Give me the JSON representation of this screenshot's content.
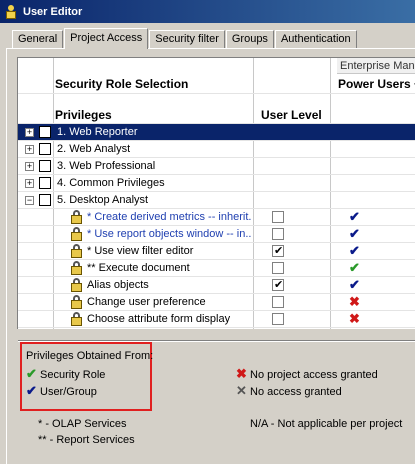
{
  "window": {
    "title": "User Editor"
  },
  "tabs": [
    {
      "label": "General"
    },
    {
      "label": "Project Access"
    },
    {
      "label": "Security filter"
    },
    {
      "label": "Groups"
    },
    {
      "label": "Authentication"
    }
  ],
  "grid": {
    "enterprise_label": "Enterprise Manag",
    "security_role_selection": "Security Role Selection",
    "power_users": "Power Users +",
    "privileges_header": "Privileges",
    "user_level_header": "User Level",
    "rows": [
      {
        "label": "1. Web Reporter",
        "selected": true,
        "expander": "+"
      },
      {
        "label": "2. Web Analyst",
        "expander": "+"
      },
      {
        "label": "3. Web Professional",
        "expander": "+"
      },
      {
        "label": "4. Common Privileges",
        "expander": "+"
      },
      {
        "label": "5. Desktop Analyst",
        "expander": "−"
      }
    ],
    "subrows": [
      {
        "label": "* Create derived metrics -- inherit...",
        "link": true,
        "user_level": false,
        "mark": "✔",
        "mark_color": "blue"
      },
      {
        "label": "* Use report objects window -- in...",
        "link": true,
        "user_level": false,
        "mark": "✔",
        "mark_color": "blue"
      },
      {
        "label": "* Use view filter editor",
        "link": false,
        "user_level": true,
        "mark": "✔",
        "mark_color": "blue"
      },
      {
        "label": "** Execute document",
        "link": false,
        "user_level": false,
        "mark": "✔",
        "mark_color": "green"
      },
      {
        "label": "Alias objects",
        "link": false,
        "user_level": true,
        "mark": "✔",
        "mark_color": "blue"
      },
      {
        "label": "Change user preference",
        "link": false,
        "user_level": false,
        "mark": "✖",
        "mark_color": "red"
      },
      {
        "label": "Choose attribute form display",
        "link": false,
        "user_level": false,
        "mark": "✖",
        "mark_color": "red"
      }
    ]
  },
  "legend": {
    "title": "Privileges Obtained From:",
    "security_role": "Security Role",
    "user_group": "User/Group",
    "no_project_access": "No project access granted",
    "no_access": "No access granted",
    "olap": "* - OLAP Services",
    "report_services": "** - Report Services",
    "na": "N/A - Not applicable per project"
  },
  "colors": {
    "blue_check": "#0a1a8a",
    "green_check": "#2a9a2a",
    "red_x": "#d01818",
    "selection": "#0a246a"
  }
}
